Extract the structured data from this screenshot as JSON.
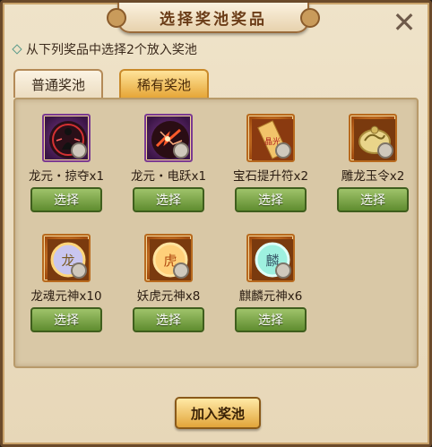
{
  "dialog": {
    "title": "选择奖池奖品",
    "close_glyph": "✕"
  },
  "instruction": "从下列奖品中选择2个放入奖池",
  "tabs": [
    {
      "label": "普通奖池",
      "active": false
    },
    {
      "label": "稀有奖池",
      "active": true
    }
  ],
  "items": [
    {
      "name": "龙元・掠夺x1",
      "button": "选择",
      "icon": "dragon-yuan-plunder-icon"
    },
    {
      "name": "龙元・电跃x1",
      "button": "选择",
      "icon": "dragon-yuan-lightning-icon"
    },
    {
      "name": "宝石提升符x2",
      "button": "选择",
      "icon": "gem-upgrade-talisman-icon"
    },
    {
      "name": "雕龙玉令x2",
      "button": "选择",
      "icon": "carved-dragon-jade-token-icon"
    },
    {
      "name": "龙魂元神x10",
      "button": "选择",
      "icon": "dragon-soul-orb-icon"
    },
    {
      "name": "妖虎元神x8",
      "button": "选择",
      "icon": "demon-tiger-orb-icon"
    },
    {
      "name": "麒麟元神x6",
      "button": "选择",
      "icon": "qilin-orb-icon"
    }
  ],
  "orb_glyphs": [
    "龙",
    "虎",
    "麟"
  ],
  "talisman_glyph": "晶光",
  "join_button": "加入奖池",
  "colors": {
    "accent": "#e2a53a",
    "choose_button": "#5f8c2f",
    "rare_frame": "#7b3a92"
  }
}
